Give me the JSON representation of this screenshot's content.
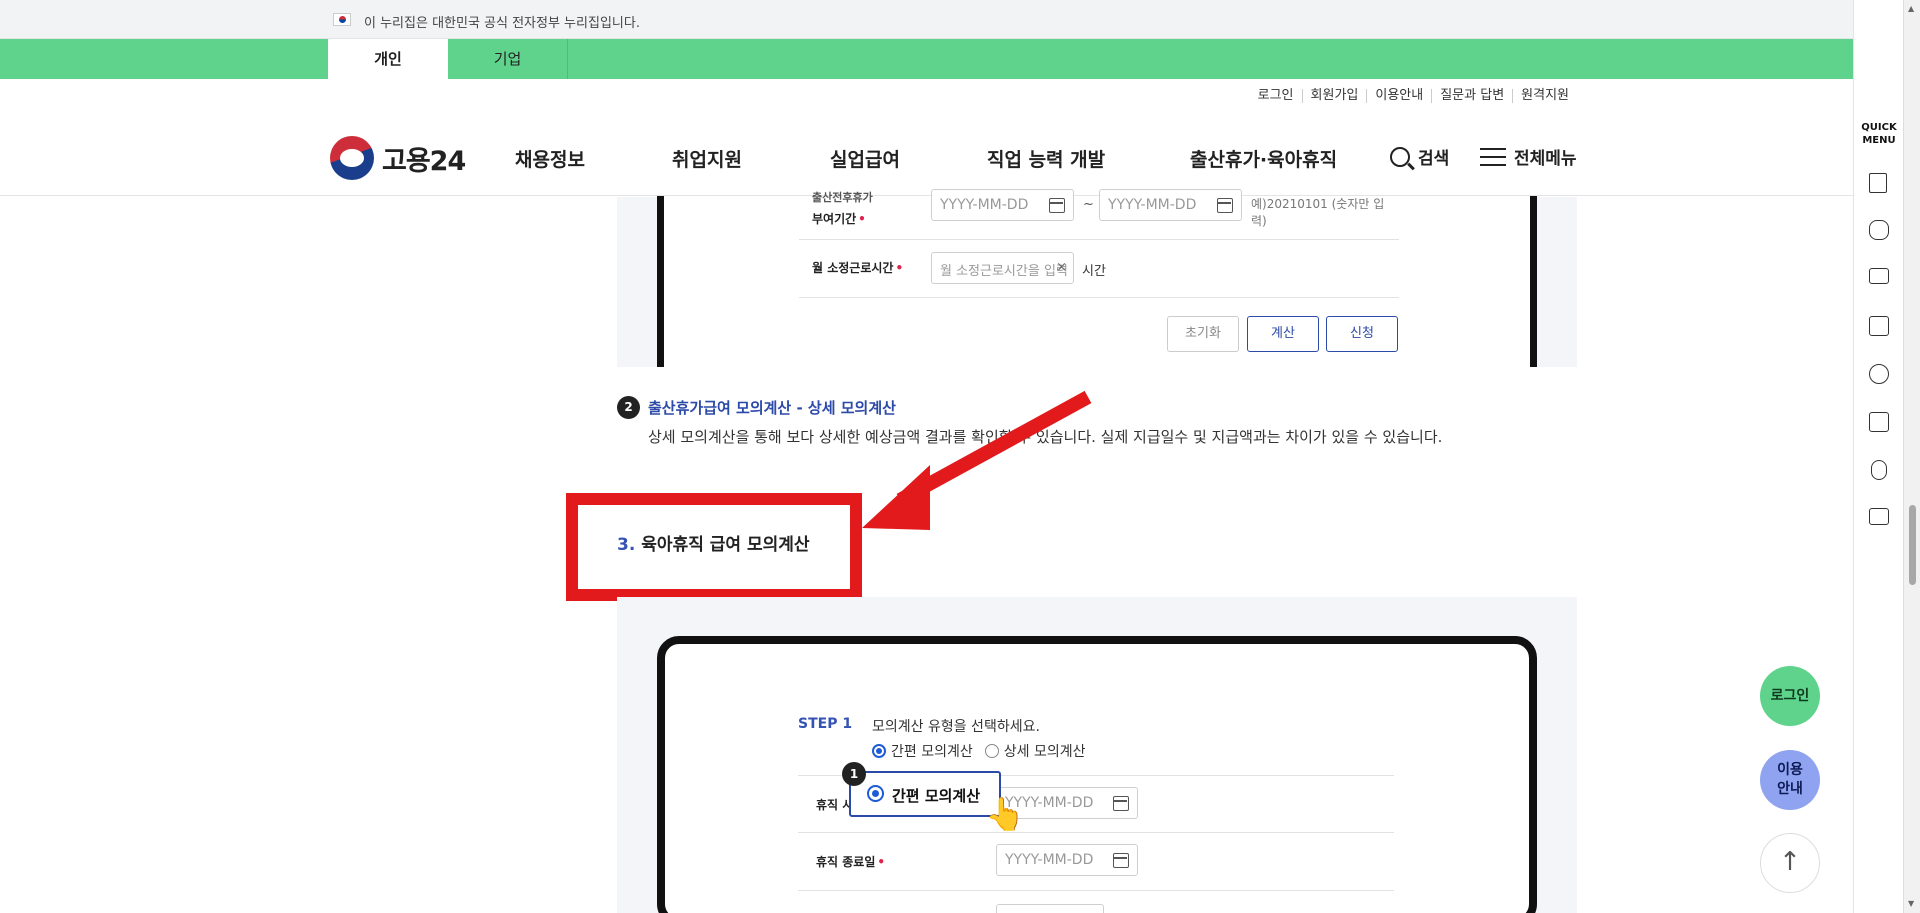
{
  "gov_banner": {
    "text": "이 누리집은 대한민국 공식 전자정부 누리집입니다."
  },
  "audience_tabs": [
    {
      "label": "개인",
      "active": true
    },
    {
      "label": "기업",
      "active": false
    }
  ],
  "util_links": [
    "로그인",
    "회원가입",
    "이용안내",
    "질문과 답변",
    "원격지원"
  ],
  "logo": {
    "text": "고용24"
  },
  "gnb": [
    "채용정보",
    "취업지원",
    "실업급여",
    "직업 능력 개발",
    "출산휴가·육아휴직"
  ],
  "search_label": "검색",
  "all_menu_label": "전체메뉴",
  "top_form": {
    "row1_label": "부여기간",
    "row1_label_cut": "출산전후휴가",
    "date_placeholder": "YYYY-MM-DD",
    "tilde": "~",
    "row1_hint": "예)20210101 (숫자만 입력)",
    "row2_label": "월 소정근로시간",
    "row2_placeholder": "월 소정근로시간을 입력",
    "row2_unit": "시간",
    "clear_symbol": "×",
    "buttons": {
      "reset": "초기화",
      "calc": "계산",
      "apply": "신청"
    }
  },
  "step2": {
    "num": "2",
    "title": "출산휴가급여 모의계산 - 상세 모의계산",
    "desc": "상세 모의계산을 통해 보다 상세한 예상금액 결과를 확인할 수 있습니다. 실제 지급일수 및 지급액과는 차이가 있을 수 있습니다."
  },
  "section3": {
    "num": "3.",
    "title": "육아휴직 급여 모의계산"
  },
  "device_form": {
    "step_label": "STEP 1",
    "step_text": "모의계산 유형을 선택하세요.",
    "radio_simple": "간편 모의계산",
    "radio_detail": "상세 모의계산",
    "row1_label": "휴직 시작일",
    "row2_label": "휴직 종료일",
    "date_placeholder": "YYYY-MM-DD",
    "callout_badge": "1",
    "callout_label": "간편 모의계산"
  },
  "quick_menu": {
    "title": "QUICK MENU",
    "icons": [
      "building-icon",
      "chat-icon",
      "monitor-icon",
      "checklist-icon",
      "smile-icon",
      "calculator-icon",
      "coins-icon",
      "printer-icon"
    ]
  },
  "floating": {
    "login": "로그인",
    "guide": "이용 안내",
    "top": "↑"
  },
  "colors": {
    "brand_green": "#5fd38c",
    "accent_blue": "#2c4aa8",
    "annotation_red": "#e31a1c"
  }
}
